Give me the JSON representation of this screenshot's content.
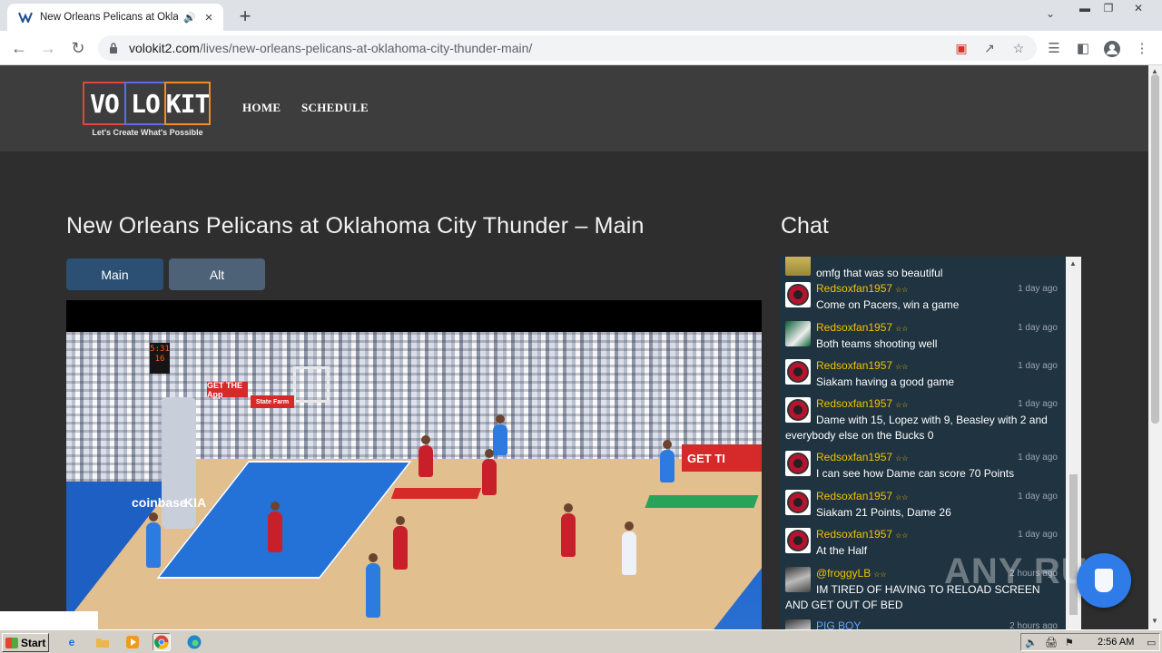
{
  "browser": {
    "tab_title": "New Orleans Pelicans at Oklahoma City Thunder",
    "url_host": "volokit2.com",
    "url_path": "/lives/new-orleans-pelicans-at-oklahoma-city-thunder-main/"
  },
  "site": {
    "logo_letters": [
      "VO",
      "LO",
      "KIT"
    ],
    "logo_tagline": "Let's Create What's Possible",
    "logo_colors": [
      "#e0473c",
      "#5b6ee8",
      "#f08a2b"
    ],
    "nav": [
      "HOME",
      "SCHEDULE"
    ]
  },
  "main": {
    "title": "New Orleans Pelicans at Oklahoma City Thunder – Main",
    "buttons": [
      "Main",
      "Alt"
    ],
    "video": {
      "shot_clock": "5:31\n16",
      "ads": [
        "GET THE App",
        "State Farm",
        "GET TI",
        "coinbase",
        "KIA"
      ]
    }
  },
  "chat": {
    "title": "Chat",
    "messages": [
      {
        "user": "",
        "stars": "",
        "time": "",
        "text": "omfg that was so beautiful",
        "avatar": "gold"
      },
      {
        "user": "Redsoxfan1957",
        "stars": "☆☆",
        "time": "1 day ago",
        "text": "Come on Pacers, win a game",
        "avatar": "raptor"
      },
      {
        "user": "Redsoxfan1957",
        "stars": "☆☆",
        "time": "1 day ago",
        "text": "Both teams shooting well",
        "avatar": "bucks"
      },
      {
        "user": "Redsoxfan1957",
        "stars": "☆☆",
        "time": "1 day ago",
        "text": "Siakam having a good game",
        "avatar": "raptor"
      },
      {
        "user": "Redsoxfan1957",
        "stars": "☆☆",
        "time": "1 day ago",
        "text": "Dame with 15, Lopez with 9, Beasley with 2 and everybody else on the Bucks 0",
        "avatar": "raptor"
      },
      {
        "user": "Redsoxfan1957",
        "stars": "☆☆",
        "time": "1 day ago",
        "text": "I can see how Dame can score 70 Points",
        "avatar": "raptor"
      },
      {
        "user": "Redsoxfan1957",
        "stars": "☆☆",
        "time": "1 day ago",
        "text": "Siakam 21 Points, Dame 26",
        "avatar": "raptor"
      },
      {
        "user": "Redsoxfan1957",
        "stars": "☆☆",
        "time": "1 day ago",
        "text": "At the Half",
        "avatar": "raptor"
      },
      {
        "user": "@froggyLB",
        "stars": "☆☆",
        "time": "2 hours ago",
        "text": "IM TIRED OF HAVING TO RELOAD SCREEN AND GET OUT OF BED",
        "avatar": "frog"
      },
      {
        "user": "PIG BOY",
        "stars": "",
        "time": "2 hours ago",
        "text": "",
        "avatar": "frog"
      }
    ]
  },
  "overlay": {
    "watermark": "ANY RUN"
  },
  "taskbar": {
    "start_label": "Start",
    "clock": "2:56 AM"
  }
}
